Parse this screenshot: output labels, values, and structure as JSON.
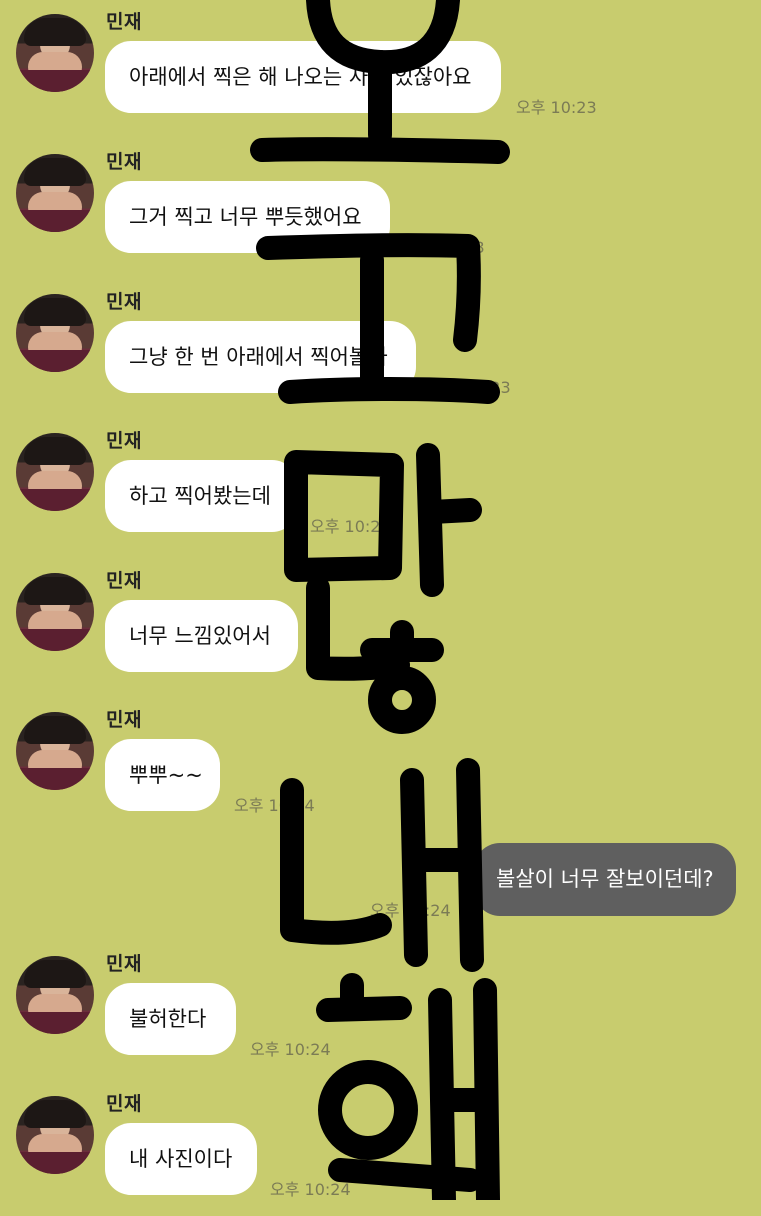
{
  "messages": [
    {
      "sender": "민재",
      "text": "아래에서 찍은 해 나오는 사진 있잖아요",
      "time": "오후 10:23"
    },
    {
      "sender": "민재",
      "text": "그거 찍고 너무 뿌듯했어요",
      "time": "오후 10:23"
    },
    {
      "sender": "민재",
      "text": "그냥 한 번 아래에서 찍어볼까",
      "time": "오후 10:23"
    },
    {
      "sender": "민재",
      "text": "하고 찍어봤는데",
      "time": "오후 10:23"
    },
    {
      "sender": "민재",
      "text": "너무 느낌있어서",
      "time": "오후 10:23"
    },
    {
      "sender": "민재",
      "text": "뿌뿌~~",
      "time": "오후 10:24"
    },
    {
      "sender": "민재",
      "text": "불허한다",
      "time": "오후 10:24"
    },
    {
      "sender": "민재",
      "text": "내 사진이다",
      "time": "오후 10:24"
    }
  ],
  "my_message": {
    "text": "볼살이 너무 잘보이던데?",
    "time": "오후 10:24"
  },
  "colors": {
    "background": "#c8cc6e",
    "bubble_in": "#ffffff",
    "bubble_out": "#5f5f5f",
    "marker": "#000000"
  },
  "icons": {
    "avatar": "profile-photo",
    "overlay": "handwritten-scribble"
  }
}
